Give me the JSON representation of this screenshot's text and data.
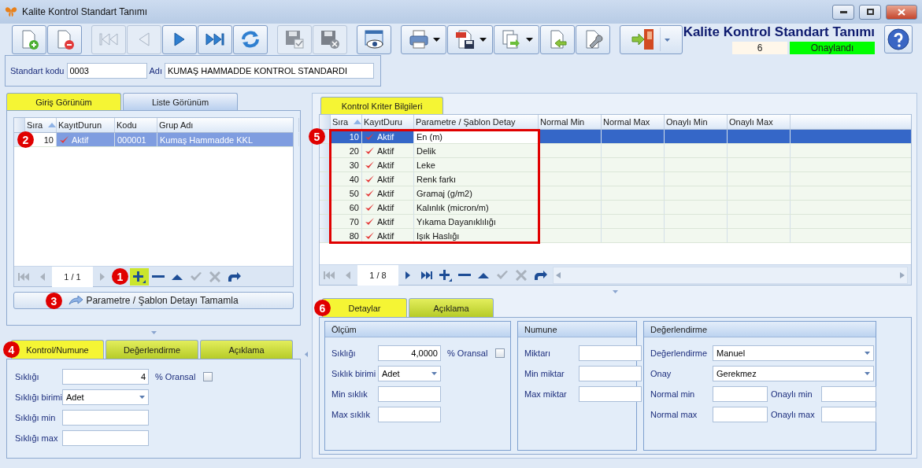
{
  "window": {
    "title": "Kalite Kontrol Standart Tanımı"
  },
  "toolbar": [
    {
      "kind": "new",
      "disabled": false,
      "dropdown": false
    },
    {
      "kind": "delete",
      "disabled": false,
      "dropdown": false
    },
    {
      "kind": "first",
      "disabled": true,
      "dropdown": false
    },
    {
      "kind": "prev",
      "disabled": true,
      "dropdown": false
    },
    {
      "kind": "next",
      "disabled": false,
      "dropdown": false
    },
    {
      "kind": "last",
      "disabled": false,
      "dropdown": false
    },
    {
      "kind": "refresh",
      "disabled": false,
      "dropdown": false
    },
    {
      "kind": "save",
      "disabled": true,
      "dropdown": false
    },
    {
      "kind": "discard",
      "disabled": true,
      "dropdown": false
    },
    {
      "kind": "preview",
      "disabled": false,
      "dropdown": false
    },
    {
      "kind": "print",
      "disabled": false,
      "dropdown": true
    },
    {
      "kind": "pdf",
      "disabled": false,
      "dropdown": true
    },
    {
      "kind": "export",
      "disabled": false,
      "dropdown": true
    },
    {
      "kind": "import",
      "disabled": false,
      "dropdown": false
    },
    {
      "kind": "tools",
      "disabled": false,
      "dropdown": false
    },
    {
      "kind": "exit",
      "disabled": false,
      "dropdown": true
    }
  ],
  "header": {
    "title": "Kalite Kontrol Standart Tanımı",
    "count": "6",
    "status": "Onaylandı"
  },
  "standard": {
    "code_label": "Standart kodu",
    "code": "0003",
    "name_label": "Adı",
    "name": "KUMAŞ HAMMADDE KONTROL STANDARDI"
  },
  "view_tabs": [
    {
      "label": "Giriş Görünüm",
      "selected": true
    },
    {
      "label": "Liste Görünüm",
      "selected": false
    }
  ],
  "group_grid": {
    "columns": [
      {
        "label": "Sıra",
        "sorted": true
      },
      {
        "label": "KayıtDurun",
        "sorted": false
      },
      {
        "label": "Kodu",
        "sorted": false
      },
      {
        "label": "Grup Adı",
        "sorted": false
      }
    ],
    "rows": [
      {
        "order": "10",
        "status": "Aktif",
        "code": "000001",
        "name": "Kumaş Hammadde KKL",
        "selected": true,
        "badge": "2"
      }
    ],
    "navigator": {
      "page": "1 / 1",
      "buttons": [
        {
          "kind": "first",
          "disabled": true,
          "highlighted": false
        },
        {
          "kind": "prev",
          "disabled": true,
          "highlighted": false
        },
        {
          "kind": "page"
        },
        {
          "kind": "next",
          "disabled": true,
          "highlighted": false
        },
        {
          "kind": "add",
          "disabled": false,
          "highlighted": true,
          "badge": "1"
        },
        {
          "kind": "remove",
          "disabled": false,
          "highlighted": false
        },
        {
          "kind": "up",
          "disabled": false,
          "highlighted": false
        },
        {
          "kind": "confirm",
          "disabled": true,
          "highlighted": false
        },
        {
          "kind": "cancel",
          "disabled": true,
          "highlighted": false
        },
        {
          "kind": "redo",
          "disabled": false,
          "highlighted": false
        }
      ]
    }
  },
  "complete_button": {
    "label": "Parametre / Şablon Detayı Tamamla",
    "badge": "3"
  },
  "control_tabs": [
    {
      "label": "Kontrol/Numune",
      "selected": true,
      "badge": "4"
    },
    {
      "label": "Değerlendirme",
      "selected": false
    },
    {
      "label": "Açıklama",
      "selected": false
    }
  ],
  "control_form": [
    [
      {
        "label": "Sıklığı",
        "kind": "number",
        "value": "4"
      },
      {
        "label": "% Oransal",
        "kind": "check",
        "checked": false
      }
    ],
    [
      {
        "label": "Sıklığı birimi",
        "kind": "select",
        "value": "Adet"
      }
    ],
    [
      {
        "label": "Sıklığı min",
        "kind": "text"
      }
    ],
    [
      {
        "label": "Sıklığı max",
        "kind": "text"
      }
    ]
  ],
  "criteria_tab": {
    "label": "Kontrol Kriter Bilgileri",
    "selected": true
  },
  "criteria_grid": {
    "highlight_badge": "5",
    "columns": [
      {
        "label": "Sıra",
        "sorted": true
      },
      {
        "label": "KayıtDuru",
        "sorted": false
      },
      {
        "label": "Parametre / Şablon Detay",
        "sorted": false
      },
      {
        "label": "Normal Min",
        "sorted": false
      },
      {
        "label": "Normal Max",
        "sorted": false
      },
      {
        "label": "Onaylı Min",
        "sorted": false
      },
      {
        "label": "Onaylı Max",
        "sorted": false
      }
    ],
    "rows": [
      {
        "order": "10",
        "status": "Aktif",
        "parameter": "En (m)",
        "selected": true
      },
      {
        "order": "20",
        "status": "Aktif",
        "parameter": "Delik",
        "selected": false
      },
      {
        "order": "30",
        "status": "Aktif",
        "parameter": "Leke",
        "selected": false
      },
      {
        "order": "40",
        "status": "Aktif",
        "parameter": "Renk farkı",
        "selected": false
      },
      {
        "order": "50",
        "status": "Aktif",
        "parameter": "Gramaj (g/m2)",
        "selected": false
      },
      {
        "order": "60",
        "status": "Aktif",
        "parameter": "Kalınlık (micron/m)",
        "selected": false
      },
      {
        "order": "70",
        "status": "Aktif",
        "parameter": "Yıkama Dayanıklılığı",
        "selected": false
      },
      {
        "order": "80",
        "status": "Aktif",
        "parameter": "Işık Haslığı",
        "selected": false
      }
    ],
    "navigator": {
      "page": "1 / 8",
      "buttons": [
        {
          "kind": "first",
          "disabled": true,
          "highlighted": false
        },
        {
          "kind": "prev",
          "disabled": true,
          "highlighted": false
        },
        {
          "kind": "page"
        },
        {
          "kind": "next",
          "disabled": false,
          "highlighted": false
        },
        {
          "kind": "last",
          "disabled": false,
          "highlighted": false
        },
        {
          "kind": "add",
          "disabled": false,
          "highlighted": false
        },
        {
          "kind": "remove",
          "disabled": false,
          "highlighted": false
        },
        {
          "kind": "up",
          "disabled": false,
          "highlighted": false
        },
        {
          "kind": "confirm",
          "disabled": true,
          "highlighted": false
        },
        {
          "kind": "cancel",
          "disabled": true,
          "highlighted": false
        },
        {
          "kind": "redo",
          "disabled": false,
          "highlighted": false
        }
      ]
    }
  },
  "detail_tabs": [
    {
      "label": "Detaylar",
      "selected": true,
      "badge": "6"
    },
    {
      "label": "Açıklama",
      "selected": false
    }
  ],
  "detail_groups": [
    {
      "title": "Ölçüm",
      "rows": [
        [
          {
            "label": "Sıklığı",
            "kind": "number",
            "value": "4,0000"
          },
          {
            "label": "% Oransal",
            "kind": "check",
            "checked": false
          }
        ],
        [
          {
            "label": "Sıklık birimi",
            "kind": "select",
            "value": "Adet"
          }
        ],
        [
          {
            "label": "Min sıklık",
            "kind": "text"
          }
        ],
        [
          {
            "label": "Max sıklık",
            "kind": "text"
          }
        ]
      ]
    },
    {
      "title": "Numune",
      "rows": [
        [
          {
            "label": "Miktarı",
            "kind": "text"
          }
        ],
        [
          {
            "label": "Min miktar",
            "kind": "text"
          }
        ],
        [
          {
            "label": "Max miktar",
            "kind": "text"
          }
        ]
      ]
    },
    {
      "title": "Değerlendirme",
      "rows": [
        [
          {
            "label": "Değerlendirme",
            "kind": "select",
            "value": "Manuel"
          }
        ],
        [
          {
            "label": "Onay",
            "kind": "select",
            "value": "Gerekmez"
          }
        ],
        [
          {
            "label": "Normal min",
            "kind": "text"
          },
          {
            "label": "Onaylı min",
            "kind": "text"
          }
        ],
        [
          {
            "label": "Normal max",
            "kind": "text"
          },
          {
            "label": "Onaylı max",
            "kind": "text"
          }
        ]
      ]
    }
  ]
}
